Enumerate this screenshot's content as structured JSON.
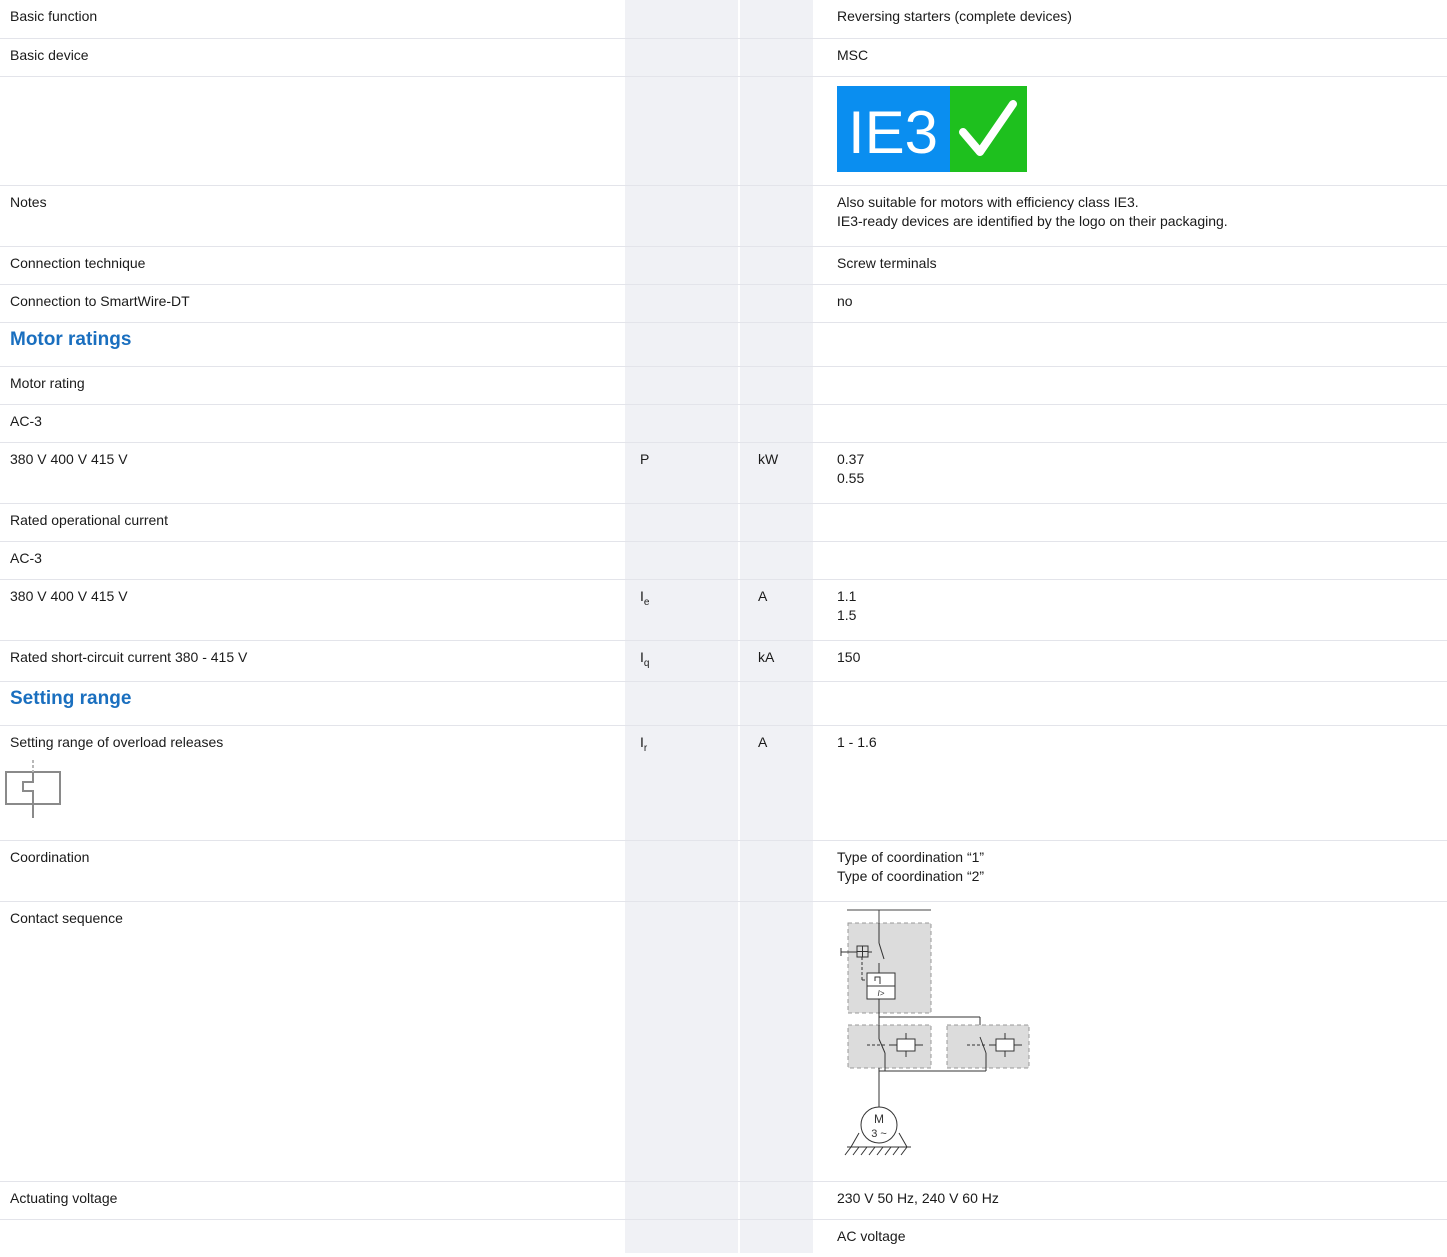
{
  "rows": {
    "basic_function": {
      "label": "Basic function",
      "value": "Reversing starters (complete devices)"
    },
    "basic_device": {
      "label": "Basic device",
      "value": "MSC"
    },
    "logo": {
      "text": "IE3",
      "blue": "#0a8ef0",
      "green": "#1ec01e"
    },
    "notes": {
      "label": "Notes",
      "value_lines": [
        "Also suitable for motors with efficiency class IE3.",
        "IE3-ready devices are identified by the logo on their packaging."
      ]
    },
    "connection_technique": {
      "label": "Connection technique",
      "value": "Screw terminals"
    },
    "smartwire": {
      "label": "Connection to SmartWire-DT",
      "value": "no"
    },
    "motor_ratings_heading": "Motor ratings",
    "motor_rating": {
      "label": "Motor rating"
    },
    "ac3_a": {
      "label": "AC-3"
    },
    "voltage_power": {
      "label": "380 V 400 V 415 V",
      "symbol": "P",
      "unit": "kW",
      "values": [
        "0.37",
        "0.55"
      ]
    },
    "rated_operational_current": {
      "label": "Rated operational current"
    },
    "ac3_b": {
      "label": "AC-3"
    },
    "voltage_current": {
      "label": "380 V 400 V 415 V",
      "symbol": "I",
      "symbol_sub": "e",
      "unit": "A",
      "values": [
        "1.1",
        "1.5"
      ]
    },
    "short_circuit": {
      "label": "Rated short-circuit current 380 - 415 V",
      "symbol": "I",
      "symbol_sub": "q",
      "unit": "kA",
      "value": "150"
    },
    "setting_range_heading": "Setting range",
    "overload": {
      "label": "Setting range of overload releases",
      "symbol": "I",
      "symbol_sub": "r",
      "unit": "A",
      "value": "1 - 1.6"
    },
    "coordination": {
      "label": "Coordination",
      "value_lines": [
        "Type of coordination “1”",
        "Type of coordination “2”"
      ]
    },
    "contact_sequence": {
      "label": "Contact sequence",
      "diagram": {
        "i_label": "I>",
        "motor_label": "M",
        "motor_phase": "3 ~"
      }
    },
    "actuating_voltage": {
      "label": "Actuating voltage",
      "value": "230 V 50 Hz, 240 V 60 Hz"
    },
    "ac_voltage": {
      "value": "AC voltage"
    }
  }
}
